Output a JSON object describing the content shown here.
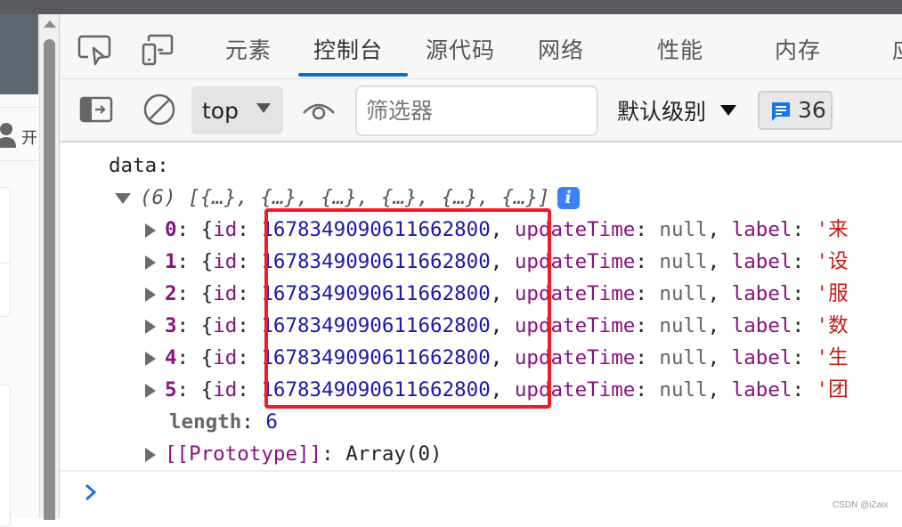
{
  "devtools": {
    "tabs": [
      {
        "label": "元素",
        "active": false
      },
      {
        "label": "控制台",
        "active": true
      },
      {
        "label": "源代码",
        "active": false
      },
      {
        "label": "网络",
        "active": false
      },
      {
        "label": "性能",
        "active": false
      },
      {
        "label": "内存",
        "active": false
      },
      {
        "label": "应",
        "active": false
      }
    ],
    "toolbar": {
      "context": "top",
      "filter_placeholder": "筛选器",
      "level": "默认级别",
      "issues_count": "36"
    }
  },
  "left_page": {
    "user_text": "开"
  },
  "console": {
    "label": "data:",
    "array_summary": "(6) [{…}, {…}, {…}, {…}, {…}, {…}]",
    "items": [
      {
        "index": "0",
        "id": "1678349090611662800",
        "updateTime": "null",
        "label_prefix": "'来"
      },
      {
        "index": "1",
        "id": "1678349090611662800",
        "updateTime": "null",
        "label_prefix": "'设"
      },
      {
        "index": "2",
        "id": "1678349090611662800",
        "updateTime": "null",
        "label_prefix": "'服"
      },
      {
        "index": "3",
        "id": "1678349090611662800",
        "updateTime": "null",
        "label_prefix": "'数"
      },
      {
        "index": "4",
        "id": "1678349090611662800",
        "updateTime": "null",
        "label_prefix": "'生"
      },
      {
        "index": "5",
        "id": "1678349090611662800",
        "updateTime": "null",
        "label_prefix": "'团"
      }
    ],
    "length_key": "length",
    "length_value": "6",
    "prototype_key": "[[Prototype]]",
    "prototype_value": "Array(0)"
  },
  "watermark": "CSDN @iZaix",
  "colors": {
    "accent": "#0a6fd1",
    "highlight": "#ee1c24",
    "number": "#1a1aa6",
    "property": "#881280"
  }
}
